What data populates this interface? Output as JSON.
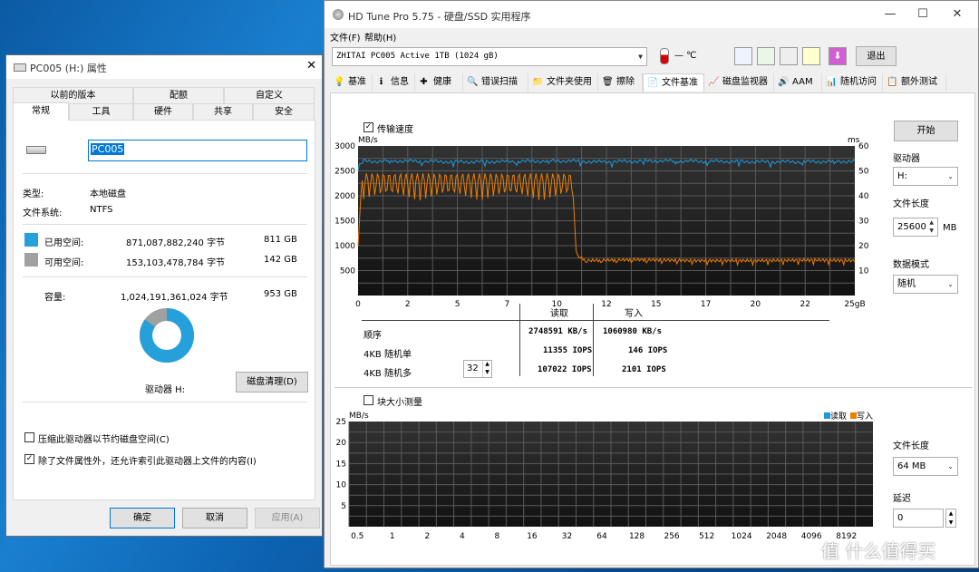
{
  "props": {
    "title": "PC005 (H:) 属性",
    "close": "✕",
    "tabs_row1": [
      "以前的版本",
      "配额",
      "自定义"
    ],
    "tabs_row2": [
      "常规",
      "工具",
      "硬件",
      "共享",
      "安全"
    ],
    "name_value": "PC005",
    "type_label": "类型:",
    "type_value": "本地磁盘",
    "fs_label": "文件系统:",
    "fs_value": "NTFS",
    "used_label": "已用空间:",
    "used_bytes": "871,087,882,240 字节",
    "used_gb": "811 GB",
    "free_label": "可用空间:",
    "free_bytes": "153,103,478,784 字节",
    "free_gb": "142 GB",
    "cap_label": "容量:",
    "cap_bytes": "1,024,191,361,024 字节",
    "cap_gb": "953 GB",
    "used_fraction": 0.849,
    "drive_label": "驱动器 H:",
    "cleanup": "磁盘清理(D)",
    "compress": "压缩此驱动器以节约磁盘空间(C)",
    "index": "除了文件属性外，还允许索引此驱动器上文件的内容(I)",
    "ok": "确定",
    "cancel": "取消",
    "apply": "应用(A)",
    "colors": {
      "used": "#26a0da",
      "free": "#a0a0a0"
    }
  },
  "hdtune": {
    "title": "HD Tune Pro 5.75 - 硬盘/SSD 实用程序",
    "menu": [
      "文件(F)",
      "帮助(H)"
    ],
    "drive": "ZHITAI PC005 Active 1TB (1024 gB)",
    "temp": "— ℃",
    "exit": "退出",
    "tabs": [
      {
        "label": "基准",
        "icon": "💡"
      },
      {
        "label": "信息",
        "icon": "ℹ"
      },
      {
        "label": "健康",
        "icon": "✚"
      },
      {
        "label": "错误扫描",
        "icon": "🔍"
      },
      {
        "label": "文件夹使用",
        "icon": "📁"
      },
      {
        "label": "擦除",
        "icon": "🗑"
      },
      {
        "label": "文件基准",
        "icon": "📄"
      },
      {
        "label": "磁盘监视器",
        "icon": "📈"
      },
      {
        "label": "AAM",
        "icon": "🔊"
      },
      {
        "label": "随机访问",
        "icon": "📊"
      },
      {
        "label": "额外测试",
        "icon": "📋"
      }
    ],
    "transfer_check": "传输速度",
    "start": "开始",
    "drive_label": "驱动器",
    "drive_value": "H:",
    "filelen_label": "文件长度",
    "filelen_value": "25600",
    "filelen_unit": "MB",
    "pattern_label": "数据模式",
    "pattern_value": "随机",
    "results": {
      "hdr_read": "读取",
      "hdr_write": "写入",
      "rows": [
        {
          "label": "顺序",
          "read": "2748591 KB/s",
          "write": "1060980 KB/s"
        },
        {
          "label": "4KB 随机单",
          "read": "11355 IOPS",
          "write": "146 IOPS"
        },
        {
          "label": "4KB 随机多",
          "read": "107022 IOPS",
          "write": "2101 IOPS"
        }
      ],
      "qd": "32"
    },
    "block_check": "块大小测量",
    "bottom_filelen_label": "文件长度",
    "bottom_filelen_value": "64 MB",
    "delay_label": "延迟",
    "delay_value": "0",
    "legend_read": "读取",
    "legend_write": "写入",
    "colors": {
      "read": "#1a9be0",
      "write": "#f07d00"
    }
  },
  "watermark": "值 什么值得买",
  "chart_data": [
    {
      "type": "line",
      "title": "",
      "xlabel": "",
      "ylabel": "MB/s",
      "y2label": "ms",
      "xlim": [
        0,
        25
      ],
      "ylim": [
        0,
        3000
      ],
      "y2lim": [
        0,
        60
      ],
      "x_ticks": [
        "0",
        "2",
        "5",
        "7",
        "10",
        "12",
        "15",
        "17",
        "20",
        "22",
        "25gB"
      ],
      "y_ticks": [
        "3000",
        "2500",
        "2000",
        "1500",
        "1000",
        "500"
      ],
      "y2_ticks": [
        "60",
        "50",
        "40",
        "30",
        "20",
        "10"
      ],
      "grid": true,
      "series": [
        {
          "name": "读取",
          "color": "#1a9be0",
          "x": [
            0,
            0.3,
            0.7,
            2,
            5,
            8,
            10.5,
            12,
            15,
            18,
            21,
            25
          ],
          "values": [
            2580,
            2700,
            2690,
            2700,
            2680,
            2690,
            2700,
            2680,
            2700,
            2690,
            2680,
            2690
          ]
        },
        {
          "name": "写入",
          "color": "#f07d00",
          "x": [
            0,
            0.3,
            1,
            3,
            5,
            7,
            9,
            10.8,
            11.0,
            11.5,
            14,
            17,
            20,
            23,
            25
          ],
          "values": [
            2200,
            2380,
            2200,
            2250,
            2220,
            2200,
            2200,
            2200,
            800,
            700,
            720,
            700,
            700,
            710,
            700
          ],
          "oscillation_band": [
            1900,
            2450
          ]
        }
      ]
    },
    {
      "type": "bar",
      "title": "",
      "ylabel": "MB/s",
      "categories": [
        "0.5",
        "1",
        "2",
        "4",
        "8",
        "16",
        "32",
        "64",
        "128",
        "256",
        "512",
        "1024",
        "2048",
        "4096",
        "8192"
      ],
      "series": [
        {
          "name": "读取",
          "values": []
        },
        {
          "name": "写入",
          "values": []
        }
      ],
      "ylim": [
        0,
        25
      ],
      "y_ticks": [
        "25",
        "20",
        "15",
        "10",
        "5"
      ],
      "grid": true,
      "legend": "top-right"
    }
  ]
}
